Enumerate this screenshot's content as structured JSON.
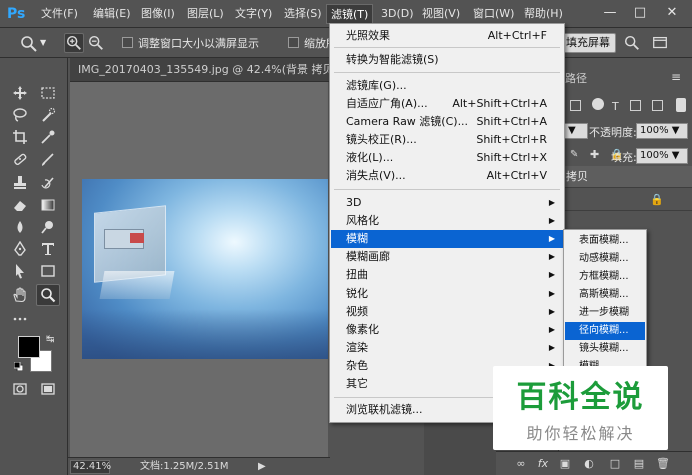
{
  "app": {
    "logo": "Ps"
  },
  "menubar": {
    "items": [
      "文件(F)",
      "编辑(E)",
      "图像(I)",
      "图层(L)",
      "文字(Y)",
      "选择(S)",
      "滤镜(T)",
      "3D(D)",
      "视图(V)",
      "窗口(W)",
      "帮助(H)"
    ],
    "active": "滤镜(T)"
  },
  "options": {
    "resize_windows_label": "调整窗口大小以满屏显示",
    "zoom_all_label": "缩放所有",
    "fill_screen_label": "填充屏幕"
  },
  "document": {
    "tab_title": "IMG_20170403_135549.jpg @ 42.4%(背景 拷贝, RGB",
    "zoom": "42.41%",
    "doc_info": "文档:1.25M/2.51M"
  },
  "filter_menu": {
    "groups": [
      [
        {
          "label": "光照效果",
          "shortcut": "Alt+Ctrl+F"
        }
      ],
      [
        {
          "label": "转换为智能滤镜(S)",
          "shortcut": ""
        }
      ],
      [
        {
          "label": "滤镜库(G)...",
          "shortcut": ""
        },
        {
          "label": "自适应广角(A)...",
          "shortcut": "Alt+Shift+Ctrl+A"
        },
        {
          "label": "Camera Raw 滤镜(C)...",
          "shortcut": "Shift+Ctrl+A"
        },
        {
          "label": "镜头校正(R)...",
          "shortcut": "Shift+Ctrl+R"
        },
        {
          "label": "液化(L)...",
          "shortcut": "Shift+Ctrl+X"
        },
        {
          "label": "消失点(V)...",
          "shortcut": "Alt+Ctrl+V"
        }
      ],
      [
        {
          "label": "3D",
          "submenu": true
        },
        {
          "label": "风格化",
          "submenu": true
        },
        {
          "label": "模糊",
          "submenu": true,
          "highlighted": true
        },
        {
          "label": "模糊画廊",
          "submenu": true
        },
        {
          "label": "扭曲",
          "submenu": true
        },
        {
          "label": "锐化",
          "submenu": true
        },
        {
          "label": "视频",
          "submenu": true
        },
        {
          "label": "像素化",
          "submenu": true
        },
        {
          "label": "渲染",
          "submenu": true
        },
        {
          "label": "杂色",
          "submenu": true
        },
        {
          "label": "其它",
          "submenu": true
        }
      ],
      [
        {
          "label": "浏览联机滤镜...",
          "shortcut": ""
        }
      ]
    ]
  },
  "blur_submenu": {
    "items": [
      "表面模糊...",
      "动感模糊...",
      "方框模糊...",
      "高斯模糊...",
      "进一步模糊",
      "径向模糊...",
      "镜头模糊...",
      "模糊"
    ],
    "highlighted": "径向模糊..."
  },
  "layers_panel": {
    "tab_label": "路径",
    "opacity_label": "不透明度:",
    "opacity_value": "100%",
    "fill_label": "填充:",
    "fill_value": "100%",
    "layer_name": "拷贝"
  },
  "watermark": {
    "title": "百科全说",
    "subtitle": "助你轻松解决"
  },
  "colors": {
    "ui_bg": "#535353",
    "menu_bg": "#f0f0f0",
    "highlight": "#0a64d2",
    "ps_blue": "#31a8ff",
    "watermark_green": "#1c9c3a"
  }
}
